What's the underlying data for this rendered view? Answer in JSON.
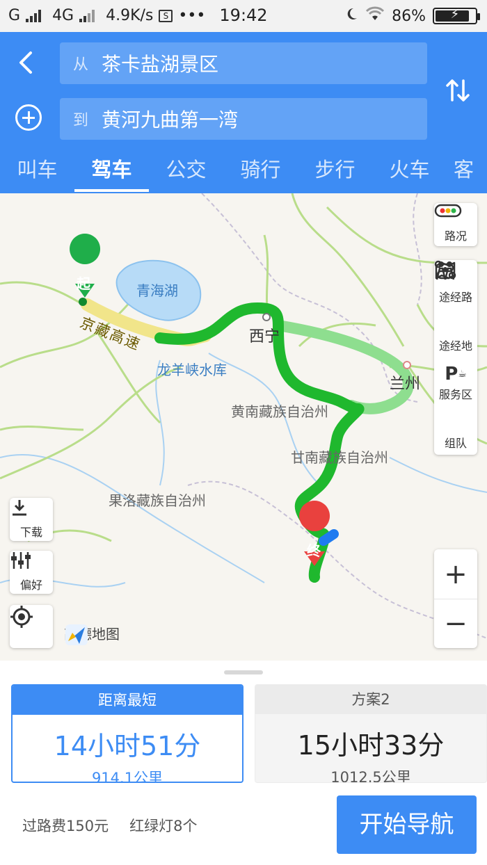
{
  "status_bar": {
    "carrier1": "G",
    "carrier2": "4G",
    "speed": "4.9K/s",
    "dots": "•••",
    "time": "19:42",
    "battery": "86%",
    "battery_level": 0.86
  },
  "route_input": {
    "from_prefix": "从",
    "from_value": "茶卡盐湖景区",
    "to_prefix": "到",
    "to_value": "黄河九曲第一湾"
  },
  "tabs": [
    {
      "label": "叫车"
    },
    {
      "label": "驾车"
    },
    {
      "label": "公交"
    },
    {
      "label": "骑行"
    },
    {
      "label": "步行"
    },
    {
      "label": "火车"
    },
    {
      "label": "客"
    }
  ],
  "active_tab": "驾车",
  "map": {
    "labels": {
      "lake": "青海湖",
      "reservoir": "龙羊峡水库",
      "xining": "西宁",
      "lanzhou": "兰州",
      "huangnan": "黄南藏族自治州",
      "gannan": "甘南藏族自治州",
      "guoluo": "果洛藏族自治州",
      "expressway": "京藏高速",
      "start_marker": "起",
      "end_marker": "终"
    },
    "controls": {
      "traffic": "路况",
      "waypoint_route": "途经路",
      "waypoint_place": "途经地",
      "service_area": "服务区",
      "team": "组队",
      "download": "下载",
      "preference": "偏好",
      "zoom_in": "+",
      "zoom_out": "−"
    },
    "brand": "高德地图"
  },
  "plans": [
    {
      "name": "距离最短",
      "time": "14小时51分",
      "distance": "914.1公里"
    },
    {
      "name": "方案2",
      "time": "15小时33分",
      "distance": "1012.5公里"
    }
  ],
  "trip_info": {
    "toll": "过路费150元",
    "lights": "红绿灯8个"
  },
  "start_button": "开始导航",
  "colors": {
    "primary": "#3d8cf4",
    "route_main": "#1fb82e",
    "route_alt": "#8ede8f"
  }
}
